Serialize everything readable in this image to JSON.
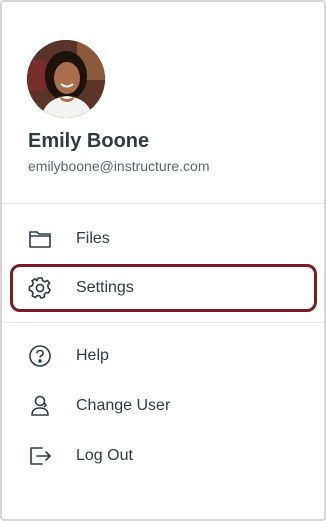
{
  "profile": {
    "name": "Emily Boone",
    "email": "emilyboone@instructure.com"
  },
  "menu": [
    {
      "label": "Files",
      "icon": "folder-icon"
    },
    {
      "label": "Settings",
      "icon": "gear-icon"
    },
    {
      "label": "Help",
      "icon": "help-icon"
    },
    {
      "label": "Change User",
      "icon": "change-user-icon"
    },
    {
      "label": "Log Out",
      "icon": "logout-icon"
    }
  ],
  "colors": {
    "text": "#2d3b45",
    "muted": "#556572",
    "highlight": "#7a1c22"
  }
}
